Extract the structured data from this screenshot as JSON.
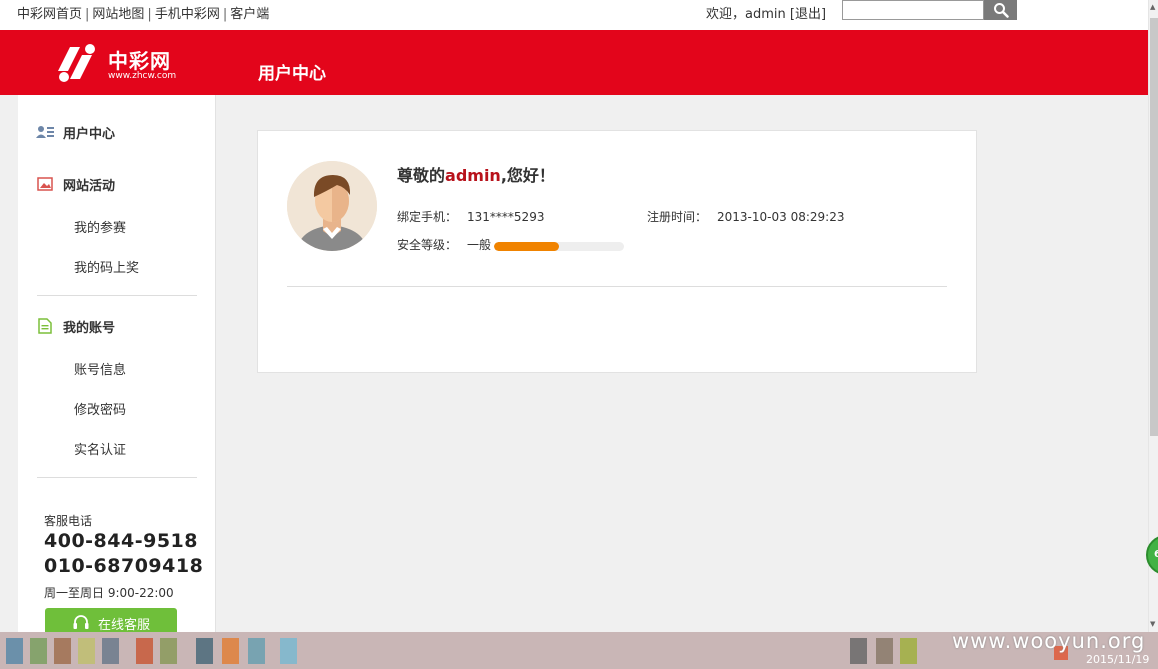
{
  "topbar": {
    "links": [
      "中彩网首页",
      "网站地图",
      "手机中彩网",
      "客户端"
    ],
    "separator": "|",
    "welcome_prefix": "欢迎，",
    "username": "admin",
    "logout": "[退出]",
    "search_placeholder": ""
  },
  "header": {
    "logo_text": "中彩网",
    "logo_sub": "www.zhcw.com",
    "title": "用户中心"
  },
  "sidebar": {
    "sections": [
      {
        "label": "用户中心",
        "icon": "user-list-icon"
      },
      {
        "label": "网站活动",
        "icon": "picture-icon",
        "items": [
          "我的参赛",
          "我的码上奖"
        ]
      },
      {
        "label": "我的账号",
        "icon": "document-icon",
        "items": [
          "账号信息",
          "修改密码",
          "实名认证"
        ]
      }
    ],
    "service": {
      "label": "客服电话",
      "phones": [
        "400-844-9518",
        "010-68709418"
      ],
      "hours": "周一至周日 9:00-22:00",
      "button": "在线客服"
    }
  },
  "profile": {
    "greet_prefix": "尊敬的",
    "name": "admin",
    "greet_suffix": ",您好！",
    "phone_label": "绑定手机：",
    "phone": "131****5293",
    "reg_label": "注册时间：",
    "reg_time": "2013-10-03 08:29:23",
    "security_label": "安全等级：",
    "security_level": "一般",
    "security_fraction": 0.5
  },
  "overlay": {
    "watermark": "www.wooyun.org",
    "date": "2015/11/19",
    "badge": "6"
  },
  "colors": {
    "brand_red": "#e3051b",
    "name_red": "#b8121b",
    "meter_orange": "#f08300",
    "service_green": "#6fbf3a"
  }
}
